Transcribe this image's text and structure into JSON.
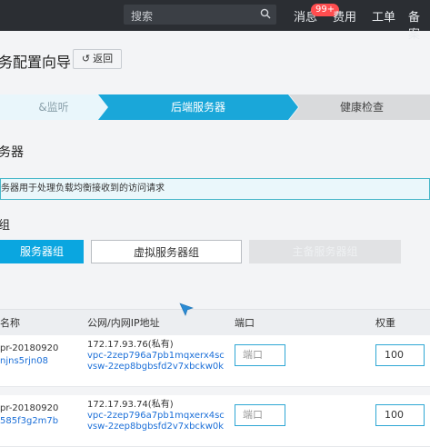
{
  "topbar": {
    "search_placeholder": "搜索",
    "messages": "消息",
    "messages_badge": "99+",
    "billing": "费用",
    "tickets": "工单",
    "filing": "备案"
  },
  "page": {
    "title": "务配置向导",
    "back_label": "返回"
  },
  "steps": [
    "&监听",
    "后端服务器",
    "健康检查"
  ],
  "section": {
    "title": "务器",
    "info": "务器用于处理负载均衡接收到的访问请求",
    "group_label": "组"
  },
  "server_types": {
    "default": "服务器组",
    "vserver": "虚拟服务器组",
    "master": "主备服务器组"
  },
  "table": {
    "headers": [
      "名称",
      "公网/内网IP地址",
      "端口",
      "权重"
    ],
    "port_placeholder": "端口",
    "rows": [
      {
        "name": "pr-20180920",
        "id": "njns5rjn08",
        "ip": "172.17.93.76(私有)",
        "vpc": "vpc-2zep796a7pb1mqxerx4sc",
        "vsw": "vsw-2zep8bgbsfd2v7xbckw0k",
        "weight": "100"
      },
      {
        "name": "pr-20180920",
        "id": "585f3g2m7b",
        "ip": "172.17.93.74(私有)",
        "vpc": "vpc-2zep796a7pb1mqxerx4sc",
        "vsw": "vsw-2zep8bgbsfd2v7xbckw0k",
        "weight": "100"
      }
    ]
  }
}
